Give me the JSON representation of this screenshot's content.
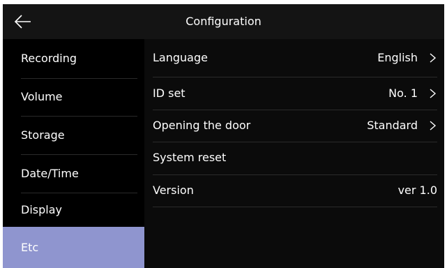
{
  "header": {
    "title": "Configuration",
    "back_icon": "arrow-left-icon"
  },
  "sidebar": {
    "items": [
      {
        "label": "Recording"
      },
      {
        "label": "Volume"
      },
      {
        "label": "Storage"
      },
      {
        "label": "Date/Time"
      },
      {
        "label": "Display"
      },
      {
        "label": "Etc",
        "selected": true
      }
    ],
    "active_color": "#8f95cf"
  },
  "settings": {
    "rows": [
      {
        "label": "Language",
        "value": "English",
        "icon": "chevron-right-icon"
      },
      {
        "label": "ID set",
        "value": "No. 1",
        "icon": "chevron-right-icon"
      },
      {
        "label": "Opening the door",
        "value": "Standard",
        "icon": "chevron-right-icon"
      },
      {
        "label": "System reset",
        "value": ""
      },
      {
        "label": "Version",
        "value": "ver 1.0"
      }
    ]
  },
  "colors": {
    "background": "#000000",
    "header": "#141414",
    "content_panel": "#0b0b0b",
    "text": "#ffffff",
    "divider": "#2b2b2b"
  }
}
